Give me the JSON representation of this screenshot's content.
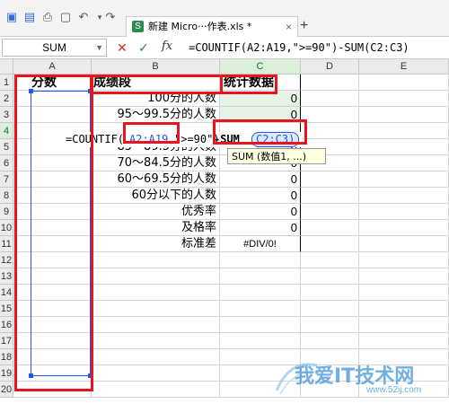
{
  "toolbar": {
    "icons": [
      "logo-icon",
      "save-icon",
      "print-icon",
      "preview-icon",
      "undo-icon",
      "redo-icon"
    ],
    "tab_label": "新建 Micro···作表.xls *",
    "tab_close": "×",
    "new_tab": "+"
  },
  "formula_bar": {
    "name_box": "SUM",
    "cancel": "✕",
    "confirm": "✓",
    "fx": "fx",
    "formula": "=COUNTIF(A2:A19,\">=90\")-SUM(C2:C3)"
  },
  "columns": [
    "A",
    "B",
    "C",
    "D",
    "E"
  ],
  "rows": [
    "1",
    "2",
    "3",
    "4",
    "5",
    "6",
    "7",
    "8",
    "9",
    "10",
    "11",
    "12",
    "13",
    "14",
    "15",
    "16",
    "17",
    "18",
    "19",
    "20"
  ],
  "cells": {
    "A1": "分数",
    "B1": "成绩段",
    "C1": "统计数据",
    "B2": "100分的人数",
    "B3": "95～99.5分的人数",
    "B5": "85～89.5分的人数",
    "B6": "70～84.5分的人数",
    "B7": "60～69.5分的人数",
    "B8": "60分以下的人数",
    "B9": "优秀率",
    "B10": "及格率",
    "B11": "标准差",
    "C2": "0",
    "C3": "0",
    "C5": "0",
    "C6": "0",
    "C7": "0",
    "C8": "0",
    "C9": "0",
    "C10": "0",
    "C11": "#DIV/0!"
  },
  "editing_formula": {
    "part1": "=COUNTIF(",
    "part2": "A2:A19,",
    "part3": "\">=90\")",
    "part4": "-SUM",
    "part5": "C2:C3)"
  },
  "tooltip": "SUM (数值1, ...)",
  "watermark": {
    "title": "我爱IT技术网",
    "url": "www.52ij.com"
  }
}
